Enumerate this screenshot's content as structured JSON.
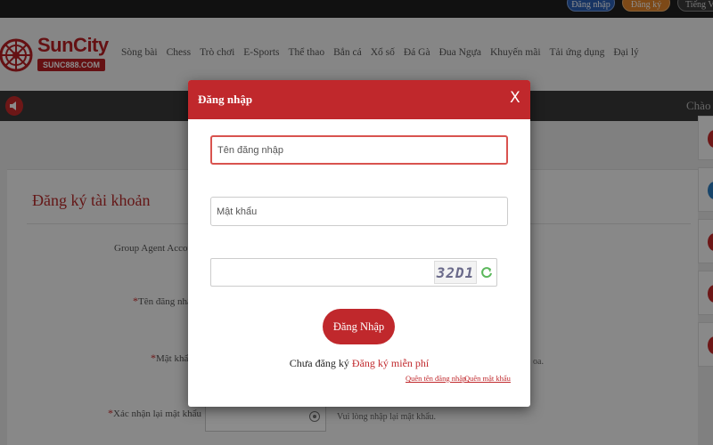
{
  "topbar": {
    "login_label": "Đăng nhập",
    "register_label": "Đăng ký",
    "language_label": "Tiếng Việt"
  },
  "logo": {
    "name": "SunCity",
    "sub": "SUNC888.COM"
  },
  "nav": {
    "items": [
      "Sòng bài",
      "Chess",
      "Trò chơi",
      "E-Sports",
      "Thể thao",
      "Bắn cá",
      "Xổ số",
      "Đá Gà",
      "Đua Ngựa",
      "Khuyến mãi",
      "Tải ứng dụng",
      "Đại lý"
    ]
  },
  "notice": {
    "text": "Chào"
  },
  "register_form": {
    "title": "Đăng ký tài khoản",
    "group_agent_label": "Group Agent Account",
    "username_label": "Tên đăng nhập",
    "password_label": "Mật khẩu",
    "confirm_label": "Xác nhận lại mật khẩu",
    "password_hint": "oa.",
    "confirm_hint": "Vui lòng nhập lại mật khẩu."
  },
  "modal": {
    "title": "Đăng nhập",
    "close_glyph": "X",
    "username_placeholder": "Tên đăng nhập",
    "password_placeholder": "Mật khẩu",
    "captcha_code": "32D1",
    "submit_label": "Đăng Nhập",
    "no_account_text": "Chưa đăng ký",
    "signup_link": "Đăng ký miễn phí",
    "forgot_username": "Quên tên đăng nhập",
    "forgot_password": "Quên mật khẩu"
  },
  "colors": {
    "brand_red": "#c0282c",
    "login_blue": "#2b5fb5",
    "register_orange": "#e3862a"
  }
}
